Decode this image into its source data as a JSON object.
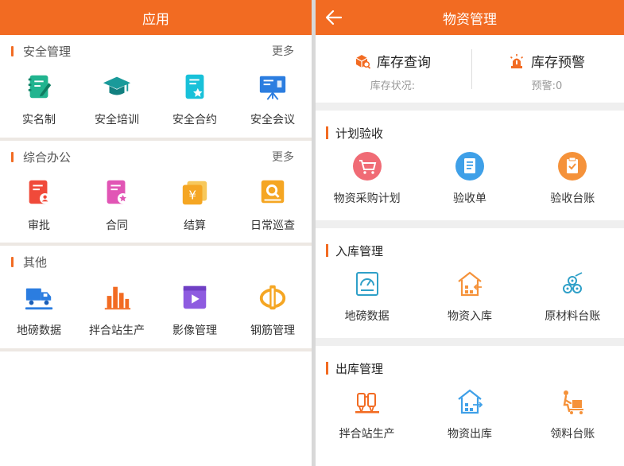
{
  "colors": {
    "accent": "#f26b22"
  },
  "left": {
    "title": "应用",
    "sections": [
      {
        "title": "安全管理",
        "more": "更多",
        "items": [
          {
            "label": "实名制",
            "icon": "notebook-pen-icon"
          },
          {
            "label": "安全培训",
            "icon": "graduation-cap-icon"
          },
          {
            "label": "安全合约",
            "icon": "document-star-icon"
          },
          {
            "label": "安全会议",
            "icon": "presentation-board-icon"
          }
        ]
      },
      {
        "title": "综合办公",
        "more": "更多",
        "items": [
          {
            "label": "审批",
            "icon": "document-user-icon"
          },
          {
            "label": "合同",
            "icon": "contract-icon"
          },
          {
            "label": "结算",
            "icon": "yuan-cards-icon"
          },
          {
            "label": "日常巡查",
            "icon": "inspection-search-icon"
          }
        ]
      },
      {
        "title": "其他",
        "items": [
          {
            "label": "地磅数据",
            "icon": "truck-scale-icon"
          },
          {
            "label": "拌合站生产",
            "icon": "bar-chart-icon"
          },
          {
            "label": "影像管理",
            "icon": "video-icon"
          },
          {
            "label": "钢筋管理",
            "icon": "rebar-icon"
          }
        ]
      }
    ]
  },
  "right": {
    "title": "物资管理",
    "stock": [
      {
        "title": "库存查询",
        "sub": "库存状况:",
        "icon": "box-search-icon"
      },
      {
        "title": "库存预警",
        "sub": "预警:0",
        "icon": "alarm-light-icon"
      }
    ],
    "sections": [
      {
        "title": "计划验收",
        "items": [
          {
            "label": "物资采购计划",
            "icon": "cart-icon"
          },
          {
            "label": "验收单",
            "icon": "receipt-icon"
          },
          {
            "label": "验收台账",
            "icon": "clipboard-check-icon"
          }
        ]
      },
      {
        "title": "入库管理",
        "items": [
          {
            "label": "地磅数据",
            "icon": "scale-gauge-icon"
          },
          {
            "label": "物资入库",
            "icon": "warehouse-in-icon"
          },
          {
            "label": "原材料台账",
            "icon": "rebar-bundle-icon"
          }
        ]
      },
      {
        "title": "出库管理",
        "items": [
          {
            "label": "拌合站生产",
            "icon": "mixing-plant-icon"
          },
          {
            "label": "物资出库",
            "icon": "warehouse-out-icon"
          },
          {
            "label": "领料台账",
            "icon": "trolley-worker-icon"
          }
        ]
      }
    ]
  }
}
